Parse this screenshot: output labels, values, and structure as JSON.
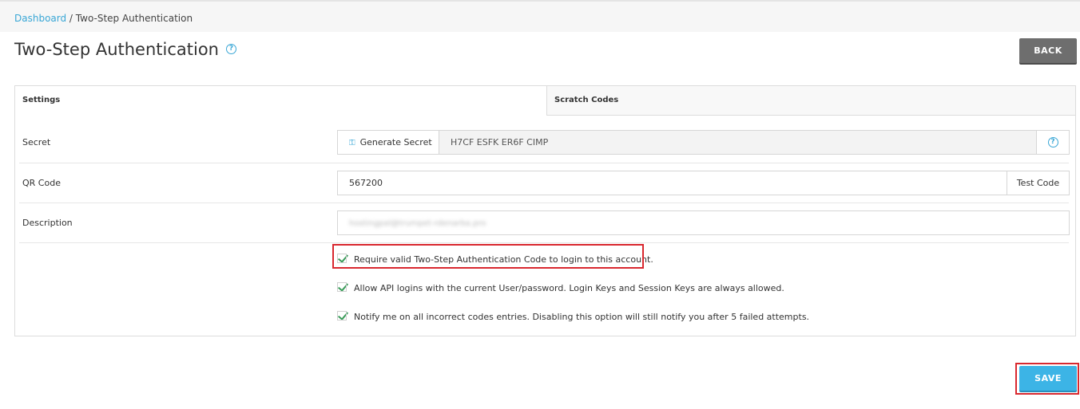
{
  "breadcrumb": {
    "home": "Dashboard",
    "separator": " / ",
    "current": "Two-Step Authentication"
  },
  "page": {
    "title": "Two-Step Authentication",
    "help_icon": "?"
  },
  "buttons": {
    "back": "BACK",
    "save": "SAVE"
  },
  "tabs": [
    {
      "label": "Settings",
      "active": true
    },
    {
      "label": "Scratch Codes",
      "active": false
    }
  ],
  "form": {
    "secret": {
      "label": "Secret",
      "generate_label": "Generate Secret",
      "value": "H7CF ESFK ER6F CIMP",
      "help_icon": "?"
    },
    "qr_code": {
      "label": "QR Code",
      "value": "567200",
      "test_label": "Test Code"
    },
    "description": {
      "label": "Description",
      "value": "hostingpal@trumpet-rdenarba.pro"
    }
  },
  "options": [
    {
      "label": "Require valid Two-Step Authentication Code to login to this account.",
      "checked": true
    },
    {
      "label": "Allow API logins with the current User/password. Login Keys and Session Keys are always allowed.",
      "checked": true
    },
    {
      "label": "Notify me on all incorrect codes entries. Disabling this option will still notify you after 5 failed attempts.",
      "checked": true
    }
  ],
  "colors": {
    "accent": "#3aa7d6",
    "check": "#3a9c5a",
    "highlight": "#d9282f",
    "back_button": "#6e6e6e",
    "save_button": "#3cb4e6"
  }
}
